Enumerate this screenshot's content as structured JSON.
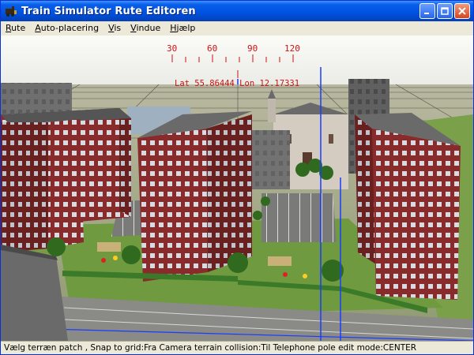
{
  "window": {
    "title": "Train Simulator Rute Editoren"
  },
  "menu": {
    "items": [
      {
        "id": "rute",
        "label": "Rute",
        "mnemonic": "R",
        "rest": "ute"
      },
      {
        "id": "auto",
        "label": "Auto-placering",
        "mnemonic": "A",
        "rest": "uto-placering"
      },
      {
        "id": "vis",
        "label": "Vis",
        "mnemonic": "V",
        "rest": "is"
      },
      {
        "id": "vindue",
        "label": "Vindue",
        "mnemonic": "V",
        "rest": "indue"
      },
      {
        "id": "help",
        "label": "Hjælp",
        "mnemonic": "H",
        "rest": "jælp"
      }
    ]
  },
  "compass": {
    "tick_labels": [
      "30",
      "60",
      "90",
      "120"
    ],
    "coordinates": "Lat 55.86444 Lon 12.17331"
  },
  "status": {
    "text": "Vælg terræn patch , Snap to grid:Fra Camera terrain collision:Til Telephone pole edit mode:CENTER"
  },
  "colors": {
    "title_bar": "#0055e5",
    "hud_red": "#d01010",
    "brick": "#8a2b2b",
    "grass": "#6f9a3f"
  }
}
